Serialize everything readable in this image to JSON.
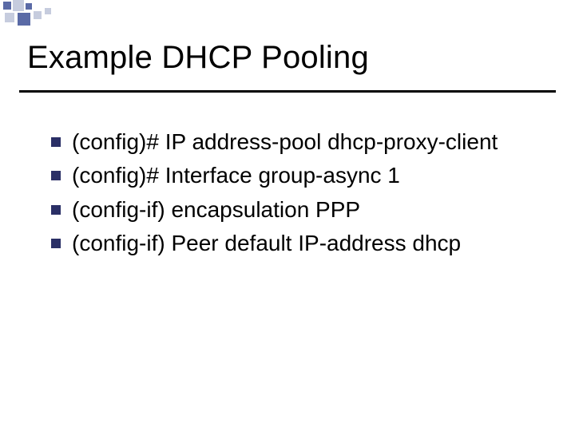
{
  "title": "Example DHCP Pooling",
  "bullets": [
    "(config)# IP address-pool dhcp-proxy-client",
    "(config)# Interface group-async 1",
    "(config-if) encapsulation PPP",
    "(config-if) Peer default IP-address dhcp"
  ],
  "theme": {
    "bullet_color": "#2a2f66",
    "accent_square_dark": "#5a6aa6",
    "accent_square_light": "#c6ccde",
    "rule_color": "#000000"
  }
}
